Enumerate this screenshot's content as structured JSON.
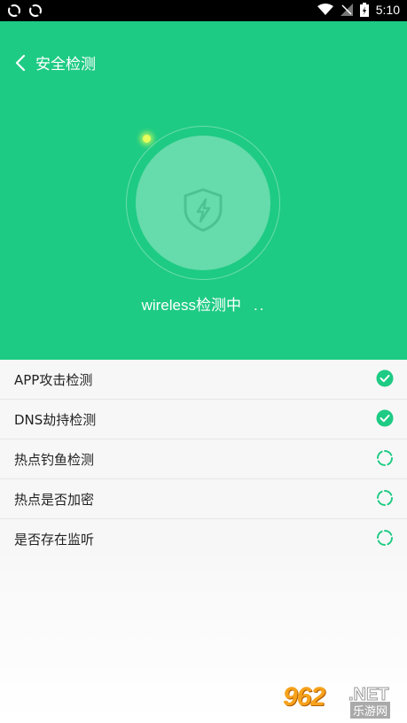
{
  "statusbar": {
    "time": "5:10"
  },
  "header": {
    "title": "安全检测",
    "status_text": "wireless检测中",
    "status_dots": ".."
  },
  "checks": [
    {
      "label": "APP攻击检测",
      "state": "done"
    },
    {
      "label": "DNS劫持检测",
      "state": "done"
    },
    {
      "label": "热点钓鱼检测",
      "state": "loading"
    },
    {
      "label": "热点是否加密",
      "state": "loading"
    },
    {
      "label": "是否存在监听",
      "state": "loading"
    }
  ],
  "watermark": {
    "number": "962",
    "suffix": ".NET",
    "text": "乐游网"
  },
  "colors": {
    "accent": "#1ecb84"
  }
}
